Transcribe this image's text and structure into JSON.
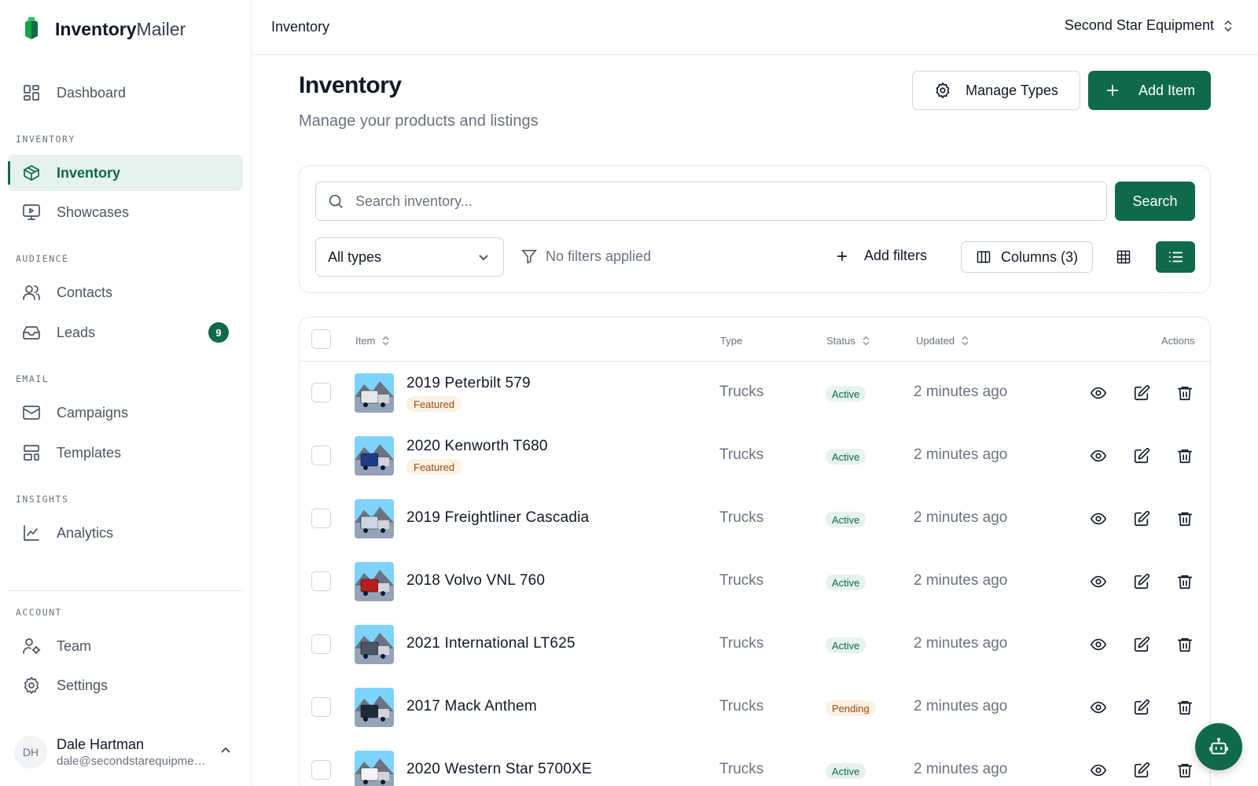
{
  "brand": {
    "name_bold": "Inventory",
    "name_light": "Mailer"
  },
  "colors": {
    "accent": "#0f6a49",
    "accent_light": "#e6f2ec",
    "featured_bg": "#fdf1e4",
    "featured_text": "#9a4a14"
  },
  "sidebar": {
    "dashboard": {
      "label": "Dashboard",
      "icon": "dashboard-icon"
    },
    "sections": {
      "inventory": "INVENTORY",
      "audience": "AUDIENCE",
      "email": "EMAIL",
      "insights": "INSIGHTS",
      "account": "ACCOUNT"
    },
    "items": {
      "inventory": {
        "label": "Inventory",
        "icon": "box-icon",
        "active": true
      },
      "showcases": {
        "label": "Showcases",
        "icon": "monitor-play-icon"
      },
      "contacts": {
        "label": "Contacts",
        "icon": "users-icon"
      },
      "leads": {
        "label": "Leads",
        "icon": "inbox-icon",
        "badge": "9"
      },
      "campaigns": {
        "label": "Campaigns",
        "icon": "mail-icon"
      },
      "templates": {
        "label": "Templates",
        "icon": "layout-template-icon"
      },
      "analytics": {
        "label": "Analytics",
        "icon": "chart-line-icon"
      },
      "team": {
        "label": "Team",
        "icon": "user-cog-icon"
      },
      "settings": {
        "label": "Settings",
        "icon": "gear-icon"
      }
    },
    "user": {
      "initials": "DH",
      "name": "Dale Hartman",
      "email": "dale@secondstarequipment.com"
    }
  },
  "topbar": {
    "title": "Inventory",
    "org": "Second Star Equipment"
  },
  "header": {
    "title": "Inventory",
    "subtitle": "Manage your products and listings",
    "manage_types_label": "Manage Types",
    "add_item_label": "Add Item"
  },
  "filters": {
    "search_placeholder": "Search inventory...",
    "search_value": "",
    "search_button": "Search",
    "type_select": "All types",
    "no_filters": "No filters applied",
    "add_filters": "Add filters",
    "columns": "Columns (3)",
    "view_mode": "list"
  },
  "table": {
    "headers": {
      "item": "Item",
      "type": "Type",
      "status": "Status",
      "updated": "Updated",
      "actions": "Actions"
    },
    "rows": [
      {
        "name": "2019 Peterbilt 579",
        "featured": "Featured",
        "type": "Trucks",
        "status": "Active",
        "updated": "2 minutes ago",
        "truck_color": "#e5e7eb"
      },
      {
        "name": "2020 Kenworth T680",
        "featured": "Featured",
        "type": "Trucks",
        "status": "Active",
        "updated": "2 minutes ago",
        "truck_color": "#1e3a8a"
      },
      {
        "name": "2019 Freightliner Cascadia",
        "featured": "",
        "type": "Trucks",
        "status": "Active",
        "updated": "2 minutes ago",
        "truck_color": "#cbd5e1"
      },
      {
        "name": "2018 Volvo VNL 760",
        "featured": "",
        "type": "Trucks",
        "status": "Active",
        "updated": "2 minutes ago",
        "truck_color": "#b91c1c"
      },
      {
        "name": "2021 International LT625",
        "featured": "",
        "type": "Trucks",
        "status": "Active",
        "updated": "2 minutes ago",
        "truck_color": "#4b5563"
      },
      {
        "name": "2017 Mack Anthem",
        "featured": "",
        "type": "Trucks",
        "status": "Pending",
        "updated": "2 minutes ago",
        "truck_color": "#1f2937"
      },
      {
        "name": "2020 Western Star 5700XE",
        "featured": "",
        "type": "Trucks",
        "status": "Active",
        "updated": "2 minutes ago",
        "truck_color": "#f3f4f6"
      }
    ],
    "row_actions": [
      "eye-icon",
      "edit-icon",
      "trash-icon"
    ]
  },
  "fab": {
    "icon": "bot-icon"
  }
}
